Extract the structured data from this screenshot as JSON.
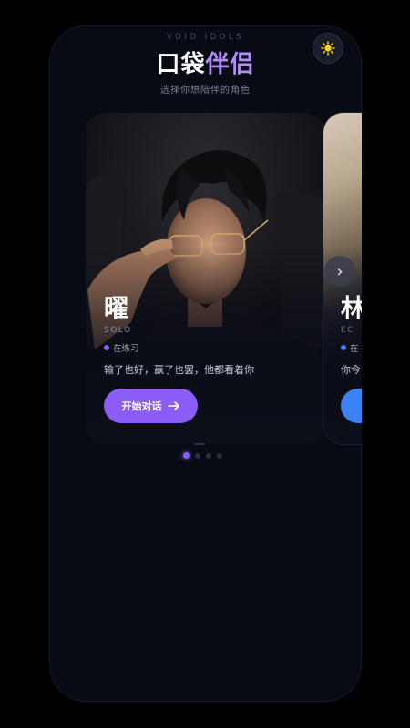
{
  "header": {
    "brand": "VOID IDOLS",
    "title_part1": "口袋",
    "title_part2": "伴侣",
    "subtitle": "选择你想陪伴的角色",
    "theme_icon": "sun-icon"
  },
  "cards": [
    {
      "name": "曜",
      "group": "SOLO",
      "status": "在练习",
      "status_color": "#8b5cf6",
      "quote": "输了也好，赢了也罢，他都看着你",
      "button_label": "开始对话",
      "button_color": "#8b5cf6"
    },
    {
      "name": "林",
      "group": "EC",
      "status": "在",
      "status_color": "#3b82f6",
      "quote": "你今",
      "button_color": "#3b82f6"
    }
  ],
  "pagination": {
    "count": 4,
    "active": 0
  },
  "colors": {
    "accent": "#8b5cf6",
    "background": "#080a14",
    "secondary": "#3b82f6"
  }
}
